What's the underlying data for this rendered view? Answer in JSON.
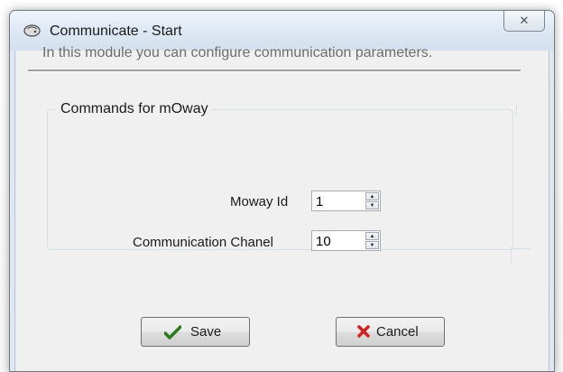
{
  "window": {
    "title": "Communicate - Start",
    "icon": "mouse-robot-icon",
    "close_glyph": "✕"
  },
  "info": {
    "text": "In this module you can configure communication parameters."
  },
  "group": {
    "title": "Commands for mOway",
    "fields": [
      {
        "label": "Moway Id",
        "value": "1"
      },
      {
        "label": "Communication Chanel",
        "value": "10"
      }
    ]
  },
  "buttons": {
    "save_label": "Save",
    "cancel_label": "Cancel"
  },
  "colors": {
    "save_icon": "#2d7a1e",
    "cancel_icon": "#d21f1f"
  }
}
